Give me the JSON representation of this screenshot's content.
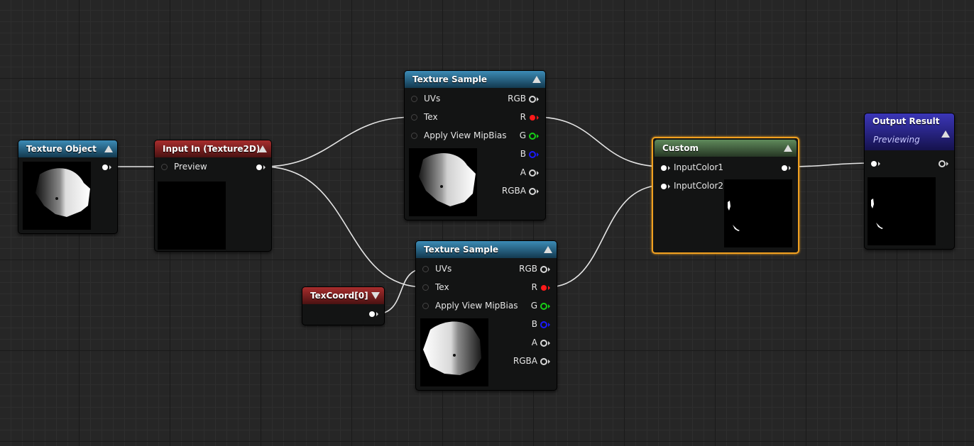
{
  "nodes": {
    "texture_object": {
      "title": "Texture Object"
    },
    "input_in": {
      "title": "Input In (Texture2D)",
      "pin_preview": "Preview"
    },
    "texture_sample_top": {
      "title": "Texture Sample",
      "inputs": [
        "UVs",
        "Tex",
        "Apply View MipBias"
      ],
      "outputs": [
        "RGB",
        "R",
        "G",
        "B",
        "A",
        "RGBA"
      ]
    },
    "texture_sample_bottom": {
      "title": "Texture Sample",
      "inputs": [
        "UVs",
        "Tex",
        "Apply View MipBias"
      ],
      "outputs": [
        "RGB",
        "R",
        "G",
        "B",
        "A",
        "RGBA"
      ]
    },
    "texcoord": {
      "title": "TexCoord[0]"
    },
    "custom": {
      "title": "Custom",
      "inputs": [
        "InputColor1",
        "InputColor2"
      ]
    },
    "output_result": {
      "title": "Output Result",
      "subtitle": "Previewing"
    }
  },
  "colors": {
    "selection": "#f0a020",
    "pin_r": "#ff1a1a",
    "pin_g": "#16d016",
    "pin_b": "#1a1aff",
    "wire": "#e8e8e8"
  }
}
